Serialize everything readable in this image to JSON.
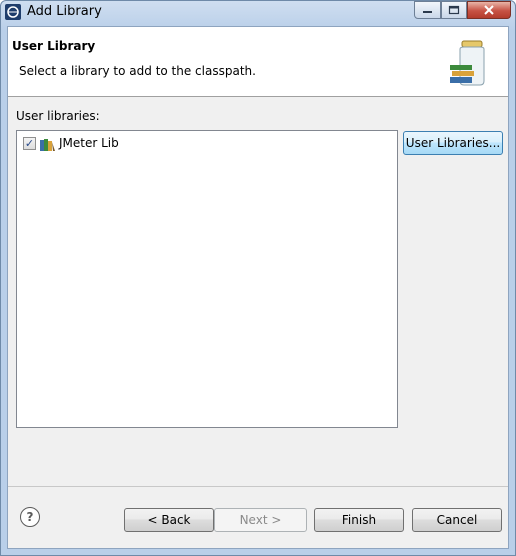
{
  "window": {
    "title": "Add Library"
  },
  "header": {
    "title": "User Library",
    "description": "Select a library to add to the classpath."
  },
  "libraries": {
    "label": "User libraries:",
    "items": [
      {
        "label": "JMeter Lib",
        "checked": true,
        "icon": "library-icon"
      }
    ],
    "user_libraries_button": "User Libraries..."
  },
  "footer": {
    "help_icon": "help-icon",
    "back_label": "< Back",
    "next_label": "Next >",
    "finish_label": "Finish",
    "cancel_label": "Cancel"
  },
  "colors": {
    "accent": "#3c7fb1",
    "titlebar": "#b9cfe9"
  }
}
